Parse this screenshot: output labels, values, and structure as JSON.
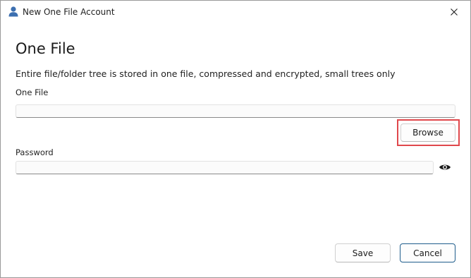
{
  "window": {
    "title": "New One File Account"
  },
  "page": {
    "heading": "One File",
    "description": "Entire file/folder tree is stored in one file, compressed and encrypted, small trees only"
  },
  "one_file": {
    "label": "One File",
    "value": "",
    "browse_label": "Browse"
  },
  "password": {
    "label": "Password",
    "value": ""
  },
  "footer": {
    "save_label": "Save",
    "cancel_label": "Cancel"
  },
  "icons": {
    "app": "user-icon",
    "close": "close-icon",
    "reveal": "eye-icon"
  },
  "colors": {
    "highlight": "#e0484c",
    "primary_border": "#1f5d8c",
    "app_icon": "#3c6fb0"
  }
}
